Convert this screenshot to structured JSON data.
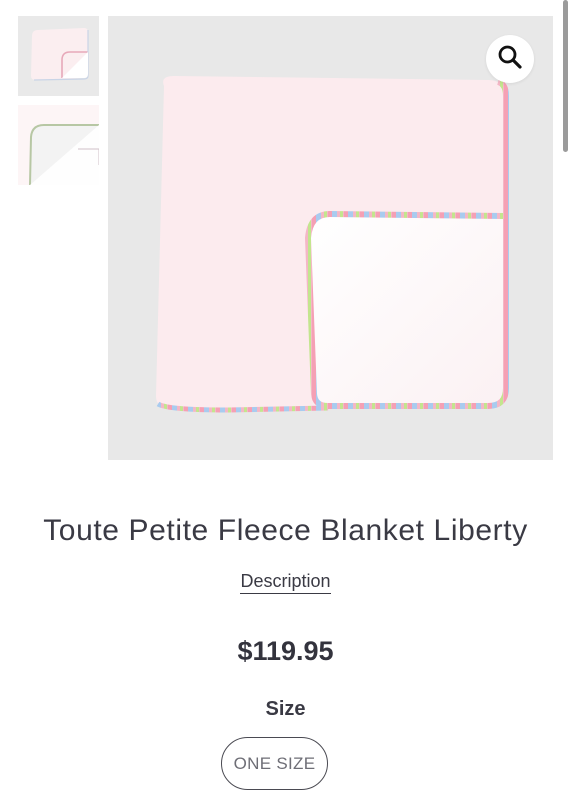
{
  "gallery": {
    "thumbnails": [
      {
        "alt": "thumbnail-folded-blanket"
      },
      {
        "alt": "thumbnail-blanket-corner"
      }
    ],
    "zoom_icon": "magnifier-icon"
  },
  "product": {
    "title": "Toute Petite Fleece Blanket Liberty",
    "description_link": "Description",
    "price": "$119.95",
    "size_label": "Size",
    "size_options": [
      "ONE SIZE"
    ]
  },
  "colors": {
    "text": "#3a3a44",
    "image_bg": "#e8e8e8",
    "blanket": "#fbe9ec",
    "trim_pink": "#f2a6b8",
    "trim_blue": "#a8c8ec",
    "trim_green": "#b9e07a"
  }
}
